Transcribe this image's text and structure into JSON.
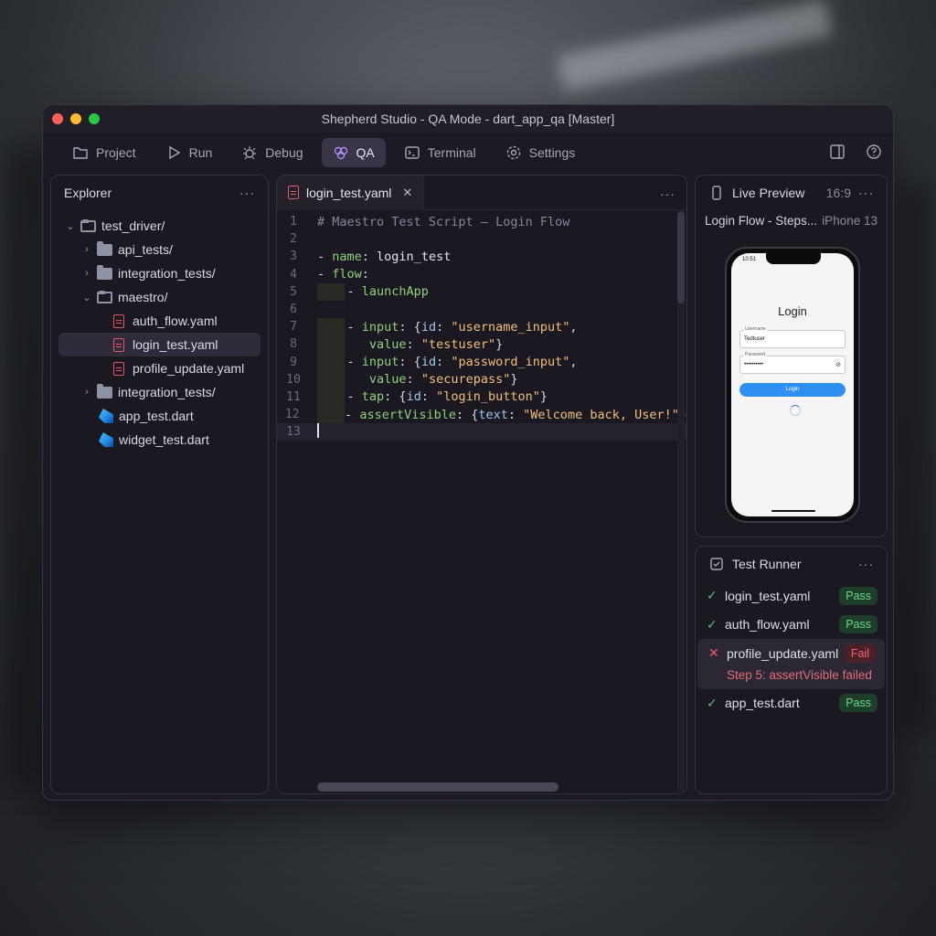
{
  "window": {
    "title": "Shepherd Studio - QA Mode - dart_app_qa [Master]"
  },
  "toolbar": {
    "items": [
      {
        "label": "Project",
        "icon": "folder-icon"
      },
      {
        "label": "Run",
        "icon": "play-icon"
      },
      {
        "label": "Debug",
        "icon": "bug-icon"
      },
      {
        "label": "QA",
        "icon": "qa-icon",
        "active": true
      },
      {
        "label": "Terminal",
        "icon": "terminal-icon"
      },
      {
        "label": "Settings",
        "icon": "gear-icon"
      }
    ],
    "right_icons": [
      "layout-icon",
      "help-icon"
    ]
  },
  "explorer": {
    "title": "Explorer",
    "tree": [
      {
        "label": "test_driver/",
        "type": "folder",
        "expanded": true
      },
      {
        "label": "api_tests/",
        "type": "folder"
      },
      {
        "label": "integration_tests/",
        "type": "folder"
      },
      {
        "label": "maestro/",
        "type": "folder",
        "expanded": true
      },
      {
        "label": "auth_flow.yaml",
        "type": "yaml"
      },
      {
        "label": "login_test.yaml",
        "type": "yaml",
        "selected": true
      },
      {
        "label": "profile_update.yaml",
        "type": "yaml"
      },
      {
        "label": "integration_tests/",
        "type": "folder"
      },
      {
        "label": "app_test.dart",
        "type": "dart"
      },
      {
        "label": "widget_test.dart",
        "type": "dart"
      }
    ]
  },
  "editor": {
    "tab_label": "login_test.yaml",
    "line_numbers": [
      "1",
      "2",
      "3",
      "4",
      "5",
      "6",
      "7",
      "8",
      "9",
      "10",
      "11",
      "12",
      "13"
    ],
    "lines": {
      "l1": "# Maestro Test Script – Login Flow",
      "l3_key": "name",
      "l3_val": "login_test",
      "l4_key": "flow",
      "l5_val": "launchApp",
      "l7_key": "input",
      "l7_id": "id",
      "l7_str": "\"username_input\"",
      "l8_key": "value",
      "l8_str": "\"testuser\"",
      "l9_key": "input",
      "l9_id": "id",
      "l9_str": "\"password_input\"",
      "l10_key": "value",
      "l10_str": "\"securepass\"",
      "l11_key": "tap",
      "l11_id": "id",
      "l11_str": "\"login_button\"",
      "l12_key": "assertVisible",
      "l12_id": "text",
      "l12_str": "\"Welcome back, User!\""
    }
  },
  "preview": {
    "title": "Live Preview",
    "aspect": "16:9",
    "subtitle": "Login Flow - Steps...",
    "device": "iPhone 13",
    "phone": {
      "time": "10:51",
      "heading": "Login",
      "username_label": "Username",
      "username_value": "Tedtuser",
      "password_label": "Password",
      "password_value": "••••••••••",
      "button": "Login"
    }
  },
  "runner": {
    "title": "Test Runner",
    "results": [
      {
        "name": "login_test.yaml",
        "status": "Pass"
      },
      {
        "name": "auth_flow.yaml",
        "status": "Pass"
      },
      {
        "name": "profile_update.yaml",
        "status": "Fail",
        "detail": "Step 5: assertVisible failed"
      },
      {
        "name": "app_test.dart",
        "status": "Pass"
      }
    ]
  },
  "colors": {
    "pass": "#4fc36b",
    "fail": "#ef5a63",
    "accent": "#3a3447",
    "yaml_icon": "#e0566a"
  }
}
